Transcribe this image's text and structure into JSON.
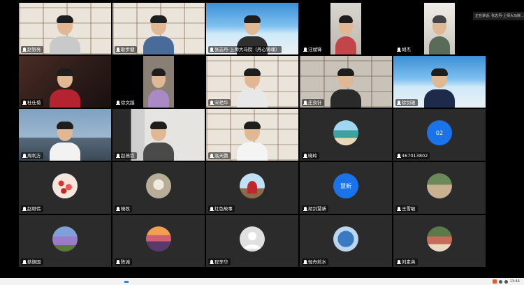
{
  "host_banner": "正在讲话: 张志丹-上师大马院...",
  "participants": [
    {
      "name": "赵银亮",
      "type": "video"
    },
    {
      "name": "耿步健",
      "type": "video"
    },
    {
      "name": "张志丹-上师大马院（丹心铸魂）",
      "type": "video"
    },
    {
      "name": "汪斌锋",
      "type": "video"
    },
    {
      "name": "胡杰",
      "type": "video"
    },
    {
      "name": "杜仕菊",
      "type": "video"
    },
    {
      "name": "徐文越",
      "type": "video"
    },
    {
      "name": "宋艳华",
      "type": "video"
    },
    {
      "name": "庄良针",
      "type": "video"
    },
    {
      "name": "徐剑雄",
      "type": "video"
    },
    {
      "name": "周利方",
      "type": "video"
    },
    {
      "name": "赵燕钦",
      "type": "video"
    },
    {
      "name": "高天鹏",
      "type": "video"
    },
    {
      "name": "晓岭",
      "type": "avatar"
    },
    {
      "name": "467013802",
      "type": "avatar",
      "avatar_text": "02"
    },
    {
      "name": "赵继伟",
      "type": "avatar"
    },
    {
      "name": "晓牧",
      "type": "avatar"
    },
    {
      "name": "红色故事",
      "type": "avatar"
    },
    {
      "name": "胡剑慧新",
      "type": "avatar",
      "avatar_text": "慧新"
    },
    {
      "name": "王雪敏",
      "type": "avatar"
    },
    {
      "name": "蔡旗国",
      "type": "avatar"
    },
    {
      "name": "陈诚",
      "type": "avatar"
    },
    {
      "name": "程李华",
      "type": "avatar"
    },
    {
      "name": "轻舟煎水",
      "type": "avatar"
    },
    {
      "name": "刘素英",
      "type": "avatar"
    }
  ],
  "colors": {
    "tile_bg": "#2b2b2b",
    "avatar_blue": "#1a73e8",
    "background": "#000000"
  },
  "taskbar": {
    "clock": "13:44"
  }
}
